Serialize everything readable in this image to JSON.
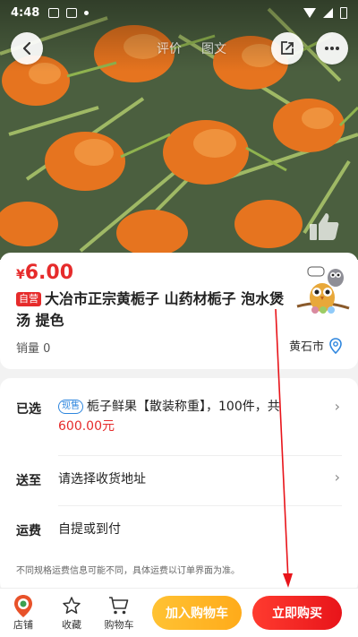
{
  "status_bar": {
    "time": "4:48"
  },
  "header": {
    "tabs": [
      "评价",
      "图文"
    ]
  },
  "product": {
    "currency": "¥",
    "price": "6.00",
    "badge": "自营",
    "title": "大冶市正宗黄栀子 山药材栀子 泡水煲汤 提色",
    "sales_label": "销量 0",
    "location": "黄石市"
  },
  "options": {
    "selected": {
      "label": "已选",
      "tag": "现售",
      "text": "栀子鲜果【散装称重】，100件，共",
      "total": "600.00元"
    },
    "ship_to": {
      "label": "送至",
      "text": "请选择收货地址"
    },
    "shipping_fee": {
      "label": "运费",
      "text": "自提或到付"
    },
    "note": "不同规格运费信息可能不同，具体运费以订单界面为准。"
  },
  "bottom_bar": {
    "shop": "店铺",
    "favorite": "收藏",
    "cart": "购物车",
    "add_to_cart": "加入购物车",
    "buy_now": "立即购买"
  },
  "colors": {
    "accent_red": "#e62b2b",
    "accent_yellow": "#ffb322",
    "tag_blue": "#2e86de"
  },
  "icons": [
    "back-icon",
    "share-icon",
    "more-icon",
    "thumbs-up-icon",
    "location-pin-icon",
    "shop-icon",
    "star-icon",
    "cart-icon",
    "chevron-right-icon"
  ]
}
